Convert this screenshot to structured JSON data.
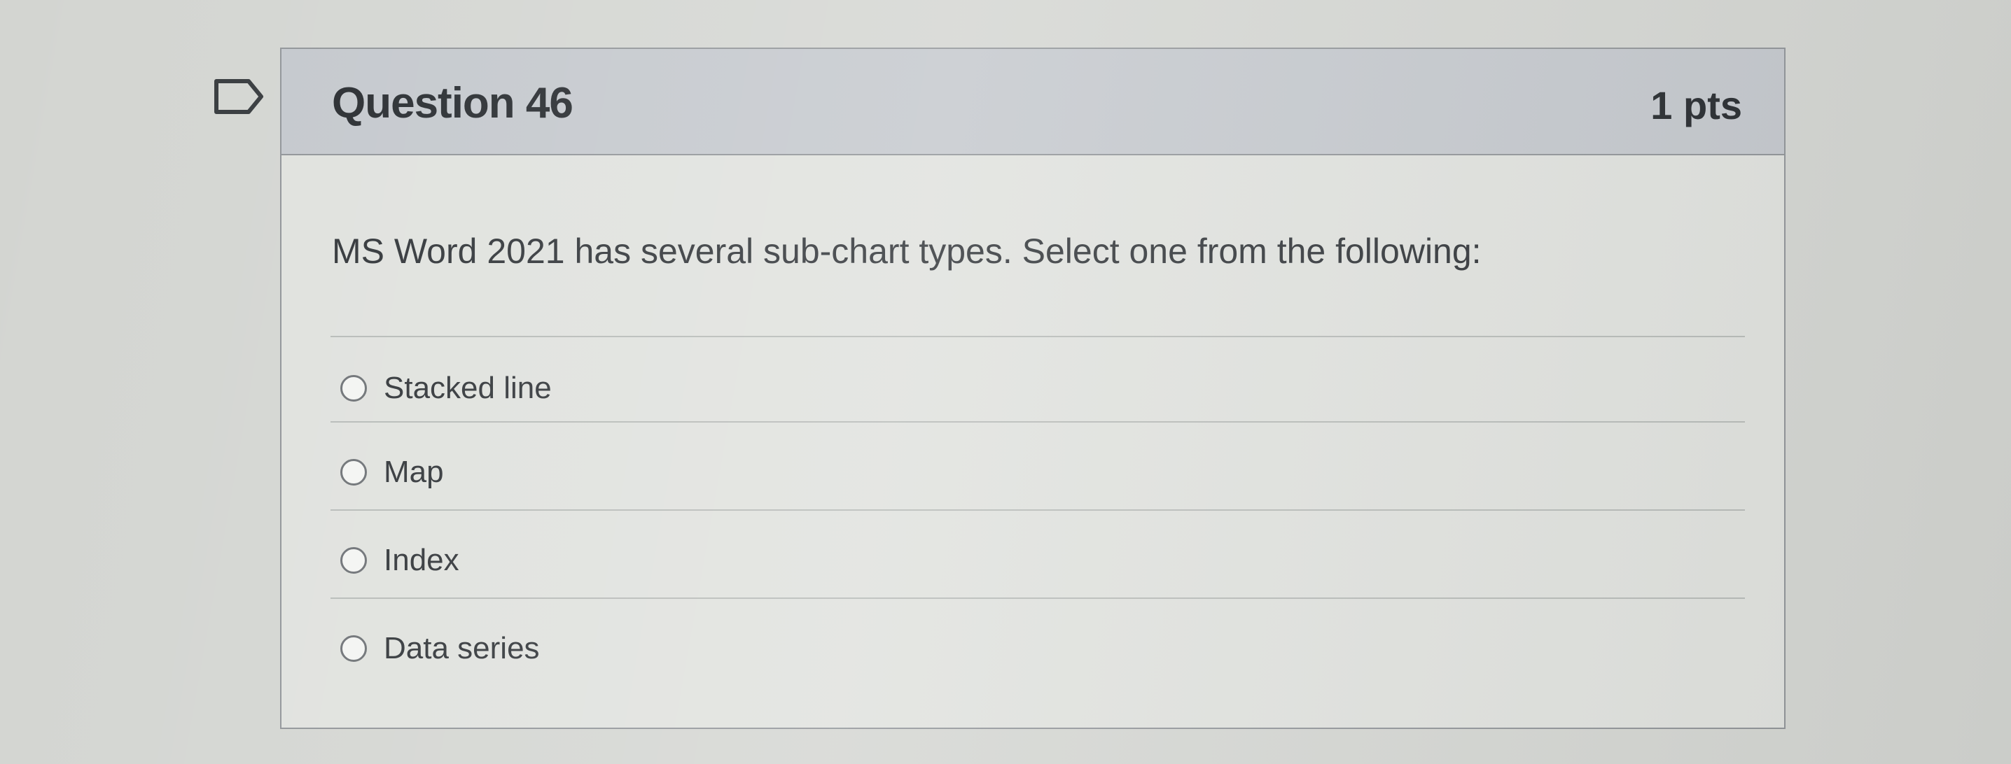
{
  "question": {
    "title": "Question 46",
    "points": "1 pts",
    "text": "MS Word 2021 has several sub-chart types. Select one from the following:",
    "flag_icon": "flag-outline-icon"
  },
  "answers": [
    {
      "label": "Stacked line",
      "selected": false
    },
    {
      "label": "Map",
      "selected": false
    },
    {
      "label": "Index",
      "selected": false
    },
    {
      "label": "Data series",
      "selected": false
    }
  ]
}
